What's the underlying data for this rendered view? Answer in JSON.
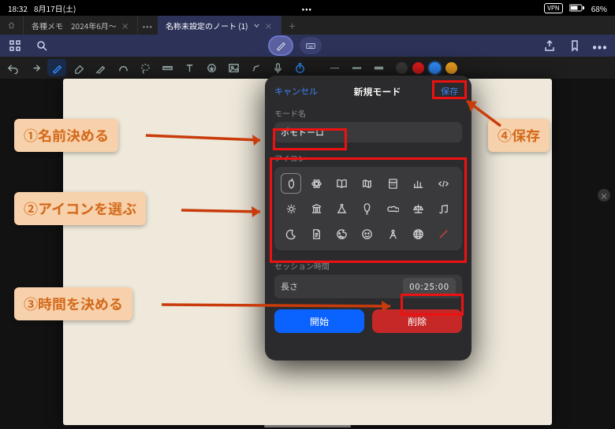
{
  "status": {
    "time": "18:32",
    "date": "8月17日(土)",
    "vpn": "VPN",
    "battery_pct": "68%"
  },
  "tabs": {
    "items": [
      {
        "title": "各種メモ　2024年6月〜",
        "active": false
      },
      {
        "title": "名称未設定のノート (1)",
        "active": true
      }
    ]
  },
  "modal": {
    "cancel": "キャンセル",
    "title": "新規モード",
    "save": "保存",
    "mode_name_label": "モード名",
    "mode_name_value": "ポモドーロ",
    "icon_label": "アイコン",
    "session_label": "セッション時間",
    "length_label": "長さ",
    "length_value": "00:25:00",
    "start": "開始",
    "delete": "削除"
  },
  "annotations": {
    "step1": "①名前決める",
    "step2": "②アイコンを選ぶ",
    "step3": "③時間を決める",
    "step4": "④保存"
  },
  "colors": {
    "accent": "#0b63ff",
    "danger": "#c62828",
    "highlight": "#e11",
    "callout_bg": "#f7d1ac",
    "callout_fg": "#d46a1a",
    "swatches": [
      "#3a3a3a",
      "#e01b1b",
      "#2f8fff",
      "#f0a020"
    ]
  }
}
